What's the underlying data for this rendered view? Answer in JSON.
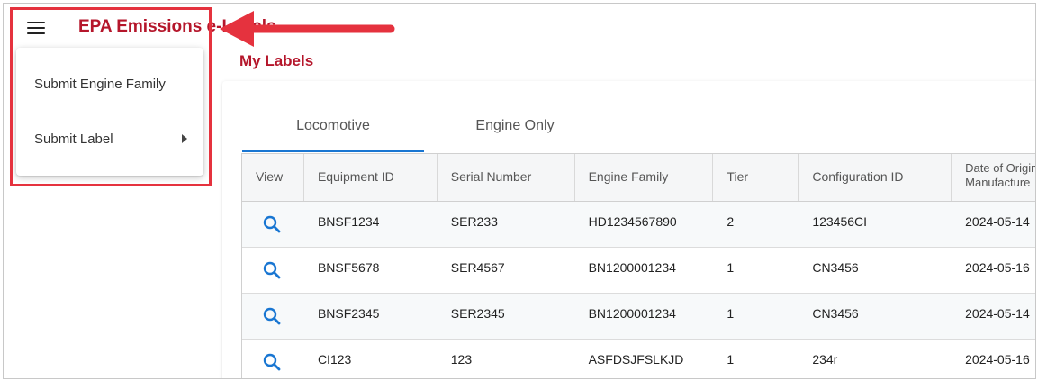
{
  "header": {
    "app_title": "EPA Emissions e-Labels",
    "page_title": "My Labels"
  },
  "menu": {
    "items": [
      {
        "label": "Submit Engine Family",
        "has_submenu": false
      },
      {
        "label": "Submit Label",
        "has_submenu": true
      }
    ]
  },
  "tabs": [
    {
      "label": "Locomotive",
      "active": true
    },
    {
      "label": "Engine Only",
      "active": false
    }
  ],
  "table": {
    "columns": [
      "View",
      "Equipment ID",
      "Serial Number",
      "Engine Family",
      "Tier",
      "Configuration ID",
      "Date of Original Manufacture"
    ],
    "rows": [
      [
        "BNSF1234",
        "SER233",
        "HD1234567890",
        "2",
        "123456CI",
        "2024-05-14"
      ],
      [
        "BNSF5678",
        "SER4567",
        "BN1200001234",
        "1",
        "CN3456",
        "2024-05-16"
      ],
      [
        "BNSF2345",
        "SER2345",
        "BN1200001234",
        "1",
        "CN3456",
        "2024-05-14"
      ],
      [
        "CI123",
        "123",
        "ASFDSJFSLKJD",
        "1",
        "234r",
        "2024-05-16"
      ]
    ],
    "view_icon": "search-icon"
  },
  "colors": {
    "brand_red": "#b5162b",
    "accent_blue": "#1976d2",
    "annotation_red": "#e5323e"
  }
}
